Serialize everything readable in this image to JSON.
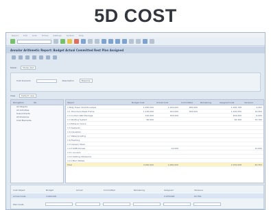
{
  "header": {
    "title": "5D COST"
  },
  "window": {
    "menu": [
      "Report",
      "Edit",
      "Goto",
      "Extras",
      "Settings",
      "System",
      "Help"
    ],
    "title": "Annular Arithmetic Report: Budget Actual Committed Rest Plan Assigned",
    "model": {
      "label": "Model",
      "value": "Model_Part"
    },
    "filter": {
      "label": "Cost Scenario",
      "value_label": "Description",
      "value": "Baseline"
    },
    "view": {
      "label": "View",
      "value": "Default view"
    },
    "tree": {
      "headers": [
        "Navigation",
        "No."
      ],
      "items": [
        "All Objects",
        "All Activities",
        "Subcontracts",
        "All Divisions",
        "Cost Elements"
      ]
    },
    "grid": {
      "headers": [
        "Object",
        "Budget Cost",
        "Actual Cost",
        "Committed",
        "Remaining",
        "Assigned Cost",
        "Variance"
      ],
      "rows": [
        [
          "1 Bldg Tower Shell Envelope",
          "1,450,000",
          "1,224,000",
          "825,000",
          "",
          "1,445,798",
          "4,202"
        ],
        [
          "  1.1 Structural Steel Frame",
          "1,120,000",
          "921,000",
          "402,000",
          "",
          "1,100,550",
          "19,450"
        ],
        [
          "  1.2 Curtain Wall Package",
          "410,000",
          "303,000",
          "",
          "",
          "404,000",
          "6,000"
        ],
        [
          "  1.3 Roofing System",
          "60,000",
          "",
          "",
          "",
          "26,300",
          "33,700"
        ],
        [
          "  1.4 Exterior Doors",
          "",
          "",
          "",
          "",
          "",
          ""
        ],
        [
          "  1.5 Sealants",
          "",
          "",
          "",
          "",
          "",
          ""
        ],
        [
          "  1.6 Insulation",
          "",
          "",
          "",
          "",
          "",
          ""
        ],
        [
          "  1.7 Waterproofing",
          "",
          "",
          "",
          "",
          "",
          ""
        ],
        [
          "  1.8 Flashing",
          "",
          "",
          "",
          "",
          "",
          ""
        ],
        [
          "  1.9 Canopy Steel",
          "",
          "",
          "",
          "",
          "",
          ""
        ],
        [
          "  1.10 Soffit Panels",
          "",
          "12,000",
          "",
          "",
          "",
          "12,000"
        ],
        [
          "  1.11 Louvers",
          "",
          "",
          "",
          "",
          "",
          ""
        ],
        [
          "  1.12 Glazing Allowance",
          "",
          "",
          "",
          "",
          "",
          ""
        ],
        [
          "  1.13 Misc Metals",
          "",
          "",
          "",
          "",
          "",
          ""
        ]
      ],
      "total": [
        "Total",
        "3,040,000",
        "2,460,000",
        "",
        "",
        "2,976,648",
        "63,352"
      ]
    },
    "summary": {
      "headers": [
        "Cost Object",
        "Budget",
        "Actual",
        "Committed",
        "Remaining",
        "Assigned",
        "Variance"
      ],
      "rows": [
        {
          "label": "Actual Costs",
          "values": [
            "3,040,000",
            "",
            "",
            "",
            "2,976,648",
            "63,352"
          ]
        },
        {
          "label": "Plan Costs",
          "values": [
            "",
            "",
            "",
            "",
            "",
            ""
          ]
        }
      ]
    }
  }
}
